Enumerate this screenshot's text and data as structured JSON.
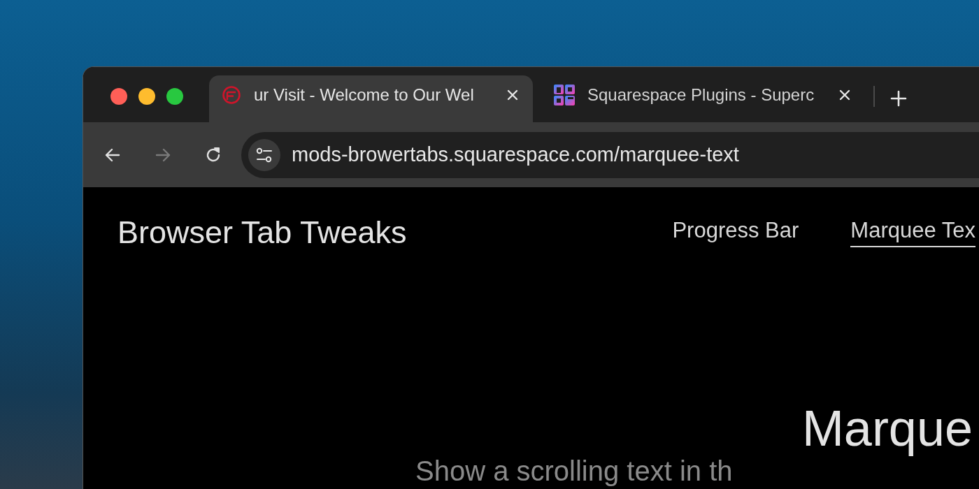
{
  "window": {
    "controls": [
      {
        "kind": "close"
      },
      {
        "kind": "minimize"
      },
      {
        "kind": "zoom"
      }
    ]
  },
  "tabs": [
    {
      "title": "ur Visit - Welcome to Our Wel",
      "selected": true
    },
    {
      "title": "Squarespace Plugins - Superc",
      "selected": false
    }
  ],
  "toolbar": {
    "back": {
      "disabled": false
    },
    "forward": {
      "disabled": true
    },
    "url": "mods-browertabs.squarespace.com/marquee-text"
  },
  "site": {
    "title": "Browser Tab Tweaks",
    "nav": [
      {
        "label": "Progress Bar",
        "selected": false
      },
      {
        "label": "Marquee Tex",
        "selected": true
      }
    ]
  },
  "hero": {
    "heading": "Marque",
    "subheading": "Show a scrolling text in th"
  }
}
